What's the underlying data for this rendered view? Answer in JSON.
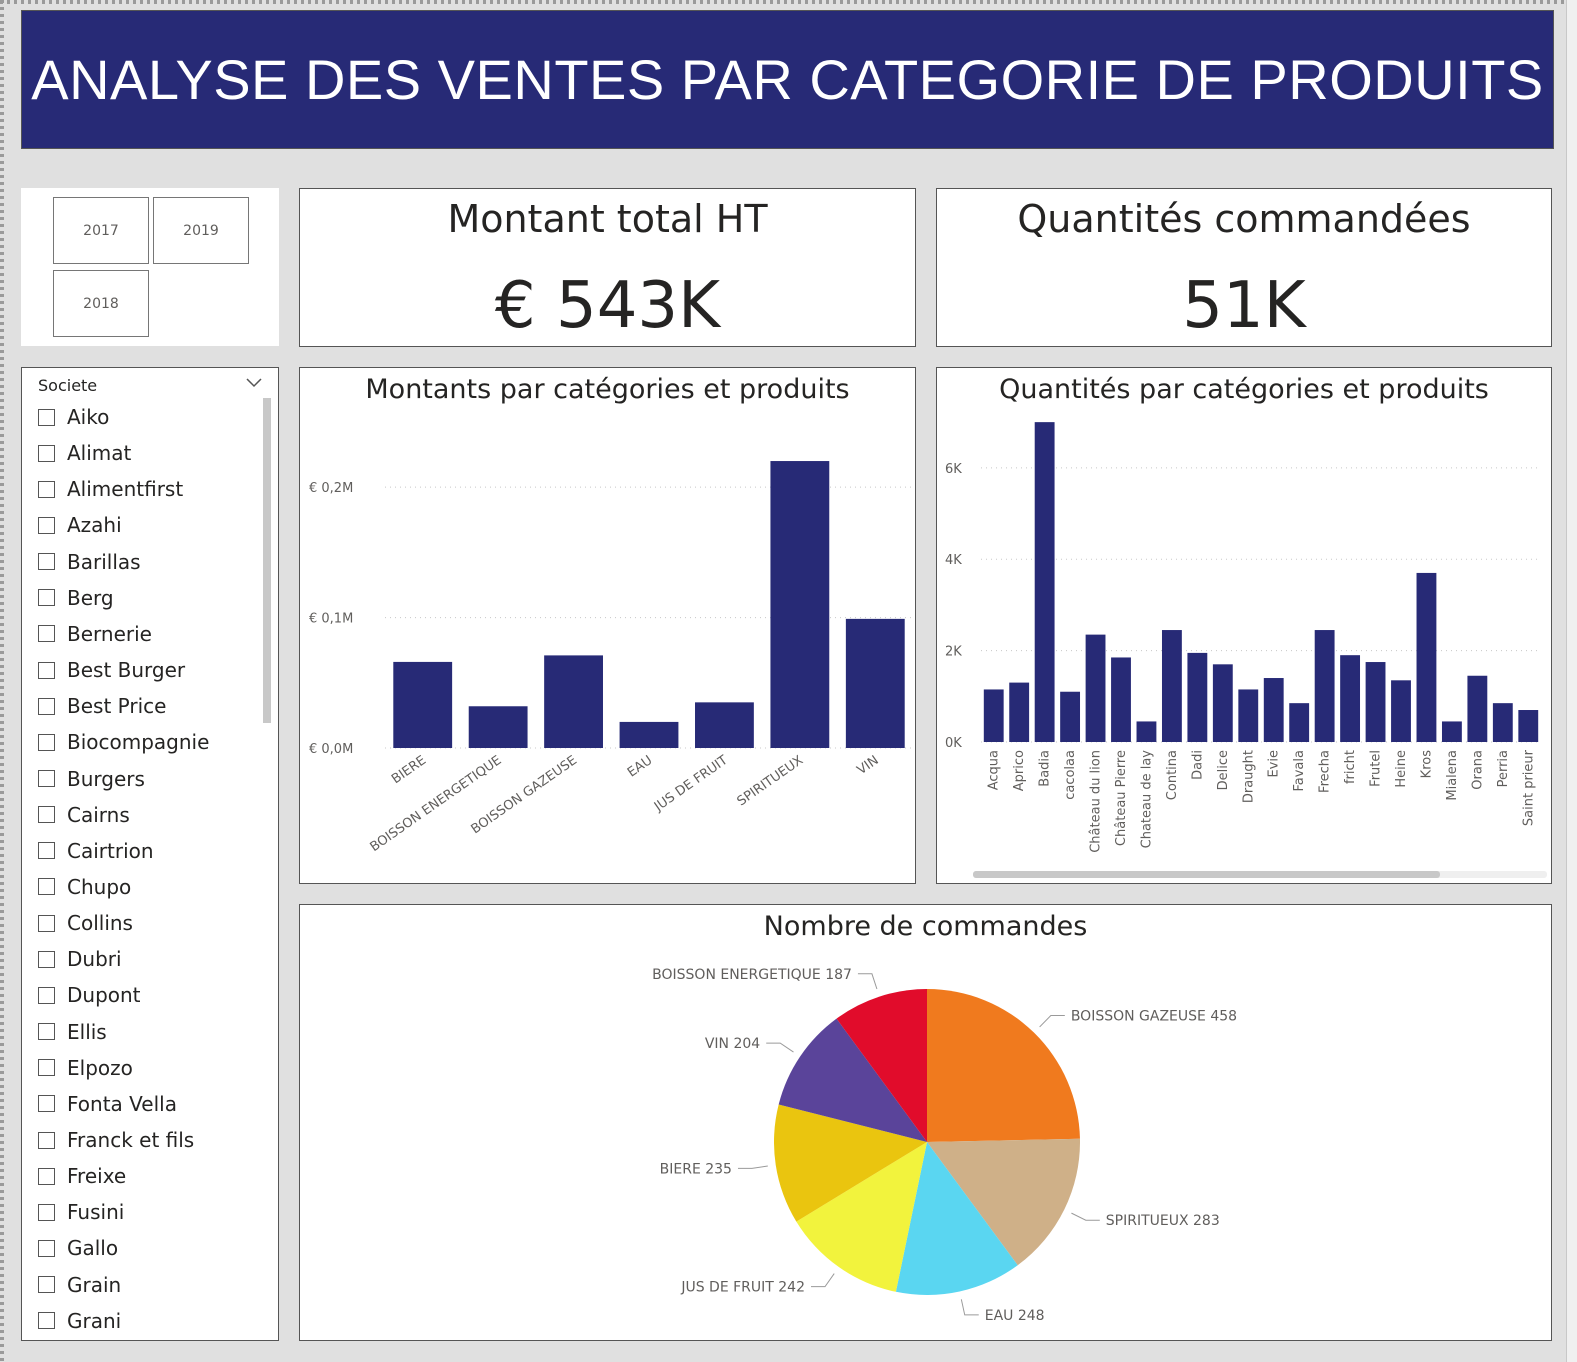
{
  "banner": {
    "title": "ANALYSE DES VENTES PAR CATEGORIE DE PRODUITS"
  },
  "year_filter": {
    "buttons": [
      "2017",
      "2019",
      "2018"
    ]
  },
  "kpi_amount": {
    "title": "Montant total HT",
    "value": "€ 543K"
  },
  "kpi_quantity": {
    "title": "Quantités commandées",
    "value": "51K"
  },
  "societe_slicer": {
    "title": "Societe",
    "items": [
      "Aiko",
      "Alimat",
      "Alimentfirst",
      "Azahi",
      "Barillas",
      "Berg",
      "Bernerie",
      "Best Burger",
      "Best Price",
      "Biocompagnie",
      "Burgers",
      "Cairns",
      "Cairtrion",
      "Chupo",
      "Collins",
      "Dubri",
      "Dupont",
      "Ellis",
      "Elpozo",
      "Fonta Vella",
      "Franck et fils",
      "Freixe",
      "Fusini",
      "Gallo",
      "Grain",
      "Grani"
    ]
  },
  "colors": {
    "bar": "#272a76",
    "banner": "#272a76"
  },
  "chart_data": [
    {
      "type": "bar",
      "title": "Montants par catégories et produits",
      "categories": [
        "BIERE",
        "BOISSON ENERGETIQUE",
        "BOISSON GAZEUSE",
        "EAU",
        "JUS DE FRUIT",
        "SPIRITUEUX",
        "VIN"
      ],
      "values": [
        66000,
        32000,
        71000,
        20000,
        35000,
        220000,
        99000
      ],
      "yticks": [
        "€ 0,0M",
        "€ 0,1M",
        "€ 0,2M"
      ],
      "ytick_values": [
        0,
        100000,
        200000
      ],
      "ylim": [
        0,
        230000
      ],
      "grid": true
    },
    {
      "type": "bar",
      "title": "Quantités par catégories et produits",
      "categories": [
        "Acqua",
        "Aprico",
        "Badia",
        "cacolaa",
        "Château du lion",
        "Château Pierre",
        "Chateau de lay",
        "Contina",
        "Dadi",
        "Delice",
        "Draught",
        "Evie",
        "Favala",
        "Frecha",
        "fricht",
        "Frutel",
        "Heine",
        "Kros",
        "Mialena",
        "Orana",
        "Perria",
        "Saint prieur"
      ],
      "values": [
        1150,
        1300,
        7000,
        1100,
        2350,
        1850,
        450,
        2450,
        1950,
        1700,
        1150,
        1400,
        850,
        2450,
        1900,
        1750,
        1350,
        3700,
        450,
        1450,
        850,
        700
      ],
      "yticks": [
        "0K",
        "2K",
        "4K",
        "6K"
      ],
      "ytick_values": [
        0,
        2000,
        4000,
        6000
      ],
      "ylim": [
        0,
        7200
      ],
      "grid": true
    },
    {
      "type": "pie",
      "title": "Nombre de commandes",
      "slices": [
        {
          "label": "BOISSON GAZEUSE 458",
          "name": "BOISSON GAZEUSE",
          "value": 458,
          "color": "#f07a1e"
        },
        {
          "label": "SPIRITUEUX 283",
          "name": "SPIRITUEUX",
          "value": 283,
          "color": "#cfb088"
        },
        {
          "label": "EAU 248",
          "name": "EAU",
          "value": 248,
          "color": "#5ad6f1"
        },
        {
          "label": "JUS DE FRUIT 242",
          "name": "JUS DE FRUIT",
          "value": 242,
          "color": "#f2f33d"
        },
        {
          "label": "BIERE 235",
          "name": "BIERE",
          "value": 235,
          "color": "#eac50f"
        },
        {
          "label": "VIN 204",
          "name": "VIN",
          "value": 204,
          "color": "#5a449a"
        },
        {
          "label": "BOISSON ENERGETIQUE 187",
          "name": "BOISSON ENERGETIQUE",
          "value": 187,
          "color": "#e10c2b"
        }
      ]
    }
  ]
}
